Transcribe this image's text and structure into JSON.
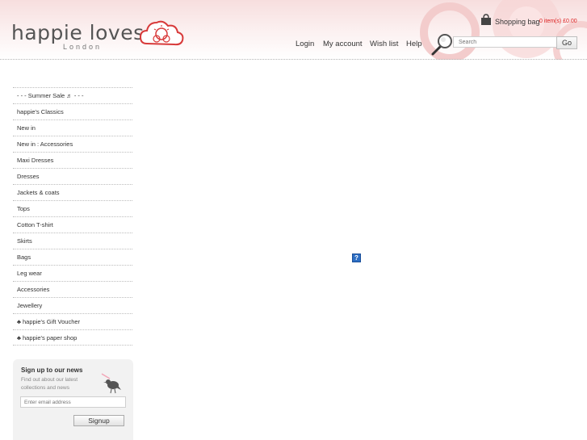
{
  "logo": {
    "name": "happie loves it",
    "sub": "London"
  },
  "bag": {
    "label": "Shopping bag",
    "count": "0 item(s) £0.00",
    "icon": "shopping-bag-icon"
  },
  "topnav": {
    "login": "Login",
    "account": "My account",
    "wishlist": "Wish list",
    "help": "Help"
  },
  "search": {
    "placeholder": "Search",
    "go": "Go",
    "icon": "magnifier-icon"
  },
  "sidebar": {
    "items": [
      "- - - Summer Sale ♬ - - -",
      "happie's Classics",
      "New in",
      "New in : Accessories",
      "Maxi Dresses",
      "Dresses",
      "Jackets & coats",
      "Tops",
      "Cotton T-shirt",
      "Skirts",
      "Bags",
      "Leg wear",
      "Accessories",
      "Jewellery",
      "♣ happie's Gift Voucher",
      "♣ happie's paper shop"
    ]
  },
  "newsletter": {
    "title": "Sign up to our news",
    "text": "Find out about our latest collections and news",
    "placeholder": "Enter email address",
    "button": "Signup"
  },
  "placeholder_image": {
    "glyph": "?"
  },
  "colors": {
    "accent": "#d22222",
    "header_pink": "#f7dede"
  }
}
